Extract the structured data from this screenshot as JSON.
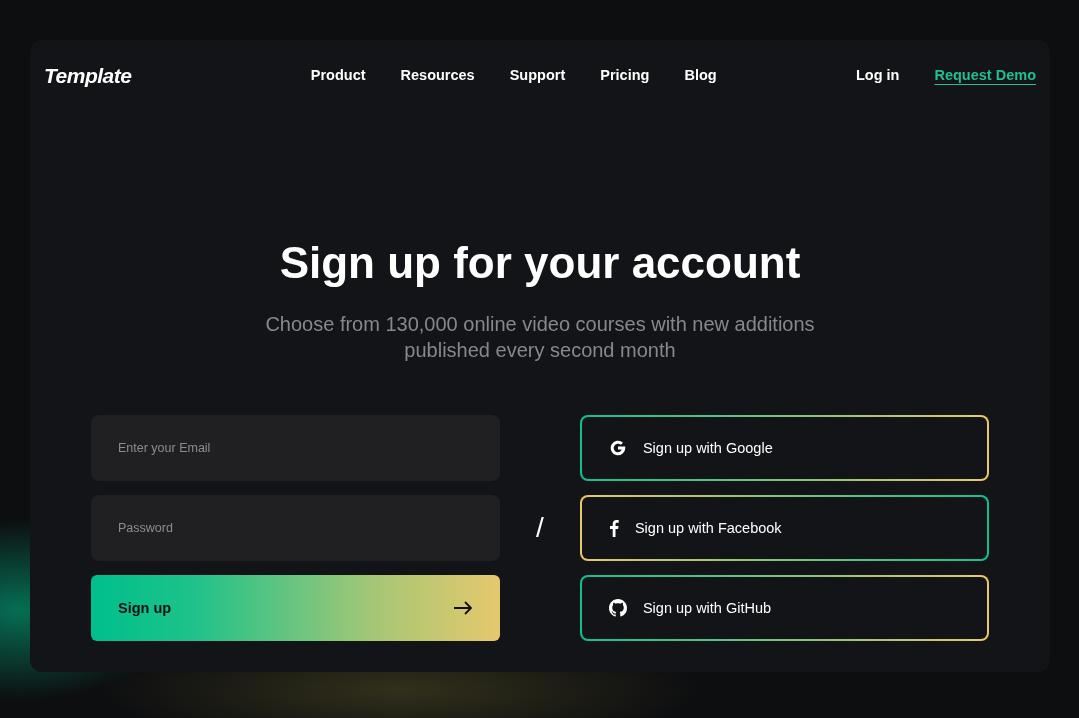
{
  "logo": "Template",
  "nav": [
    "Product",
    "Resources",
    "Support",
    "Pricing",
    "Blog"
  ],
  "login": "Log in",
  "cta": "Request Demo",
  "title": "Sign up for your account",
  "subtitle": "Choose from 130,000 online video courses with new additions published every second month",
  "form": {
    "email_placeholder": "Enter your Email",
    "password_placeholder": "Password",
    "submit": "Sign up"
  },
  "divider": "/",
  "social": [
    {
      "kind": "google",
      "label": "Sign up with Google"
    },
    {
      "kind": "facebook",
      "label": "Sign up with Facebook"
    },
    {
      "kind": "github",
      "label": "Sign up with GitHub"
    }
  ]
}
